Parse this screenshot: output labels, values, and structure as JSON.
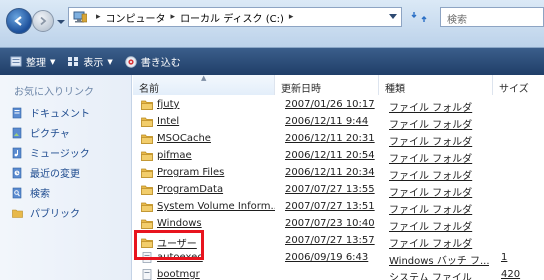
{
  "address": {
    "crumbs": [
      "コンピュータ",
      "ローカル ディスク (C:)"
    ],
    "search_placeholder": "検索"
  },
  "toolbar": {
    "organize": "整理",
    "views": "表示",
    "burn": "書き込む"
  },
  "favorites": {
    "title": "お気に入りリンク",
    "items": [
      {
        "label": "ドキュメント",
        "icon": "documents-icon"
      },
      {
        "label": "ピクチャ",
        "icon": "pictures-icon"
      },
      {
        "label": "ミュージック",
        "icon": "music-icon"
      },
      {
        "label": "最近の変更",
        "icon": "recent-changes-icon"
      },
      {
        "label": "検索",
        "icon": "searches-icon"
      },
      {
        "label": "パブリック",
        "icon": "public-folder-icon"
      }
    ]
  },
  "columns": {
    "name": "名前",
    "date": "更新日時",
    "type": "種類",
    "size": "サイズ"
  },
  "files": [
    {
      "name": "fjuty",
      "date": "2007/01/26 10:17",
      "type": "ファイル フォルダ",
      "size": ""
    },
    {
      "name": "Intel",
      "date": "2006/12/11 9:44",
      "type": "ファイル フォルダ",
      "size": ""
    },
    {
      "name": "MSOCache",
      "date": "2006/12/11 20:31",
      "type": "ファイル フォルダ",
      "size": ""
    },
    {
      "name": "pifmae",
      "date": "2006/12/11 20:54",
      "type": "ファイル フォルダ",
      "size": ""
    },
    {
      "name": "Program Files",
      "date": "2006/12/11 20:34",
      "type": "ファイル フォルダ",
      "size": ""
    },
    {
      "name": "ProgramData",
      "date": "2007/07/27 13:55",
      "type": "ファイル フォルダ",
      "size": ""
    },
    {
      "name": "System Volume Inform...",
      "date": "2007/07/27 13:51",
      "type": "ファイル フォルダ",
      "size": ""
    },
    {
      "name": "Windows",
      "date": "2007/07/23 10:40",
      "type": "ファイル フォルダ",
      "size": ""
    },
    {
      "name": "ユーザー",
      "date": "2007/07/27 13:57",
      "type": "ファイル フォルダ",
      "size": ""
    },
    {
      "name": "autoexec",
      "date": "2006/09/19 6:43",
      "type": "Windows バッチ フ...",
      "size": "1"
    },
    {
      "name": "bootmgr",
      "date": "",
      "type": "システム ファイル",
      "size": "420"
    }
  ],
  "colors": {
    "toolbar": "#2c4c78",
    "highlight": "#e8141e",
    "folder": "#e8b94a"
  }
}
